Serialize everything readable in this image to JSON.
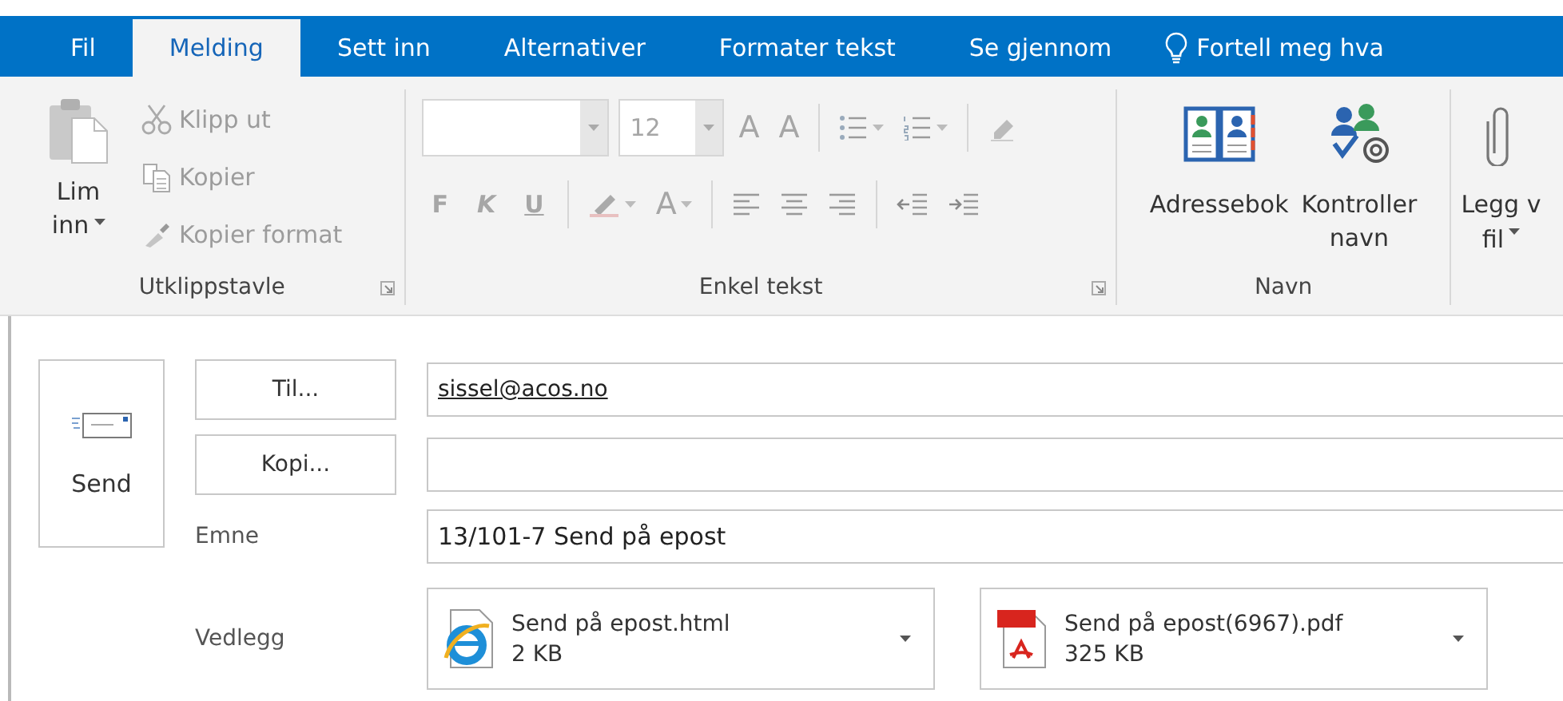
{
  "tabs": [
    {
      "label": "Fil",
      "selected": false
    },
    {
      "label": "Melding",
      "selected": true
    },
    {
      "label": "Sett inn",
      "selected": false
    },
    {
      "label": "Alternativer",
      "selected": false
    },
    {
      "label": "Formater tekst",
      "selected": false
    },
    {
      "label": "Se gjennom",
      "selected": false
    }
  ],
  "tell_me": {
    "label": "Fortell meg hva"
  },
  "clipboard": {
    "title": "Utklippstavle",
    "paste": {
      "lines": [
        "Lim",
        "inn"
      ],
      "disabled": false
    },
    "items": [
      {
        "label": "Klipp ut",
        "kind": "cut",
        "disabled": true
      },
      {
        "label": "Kopier",
        "kind": "copy",
        "disabled": true
      },
      {
        "label": "Kopier format",
        "kind": "brush",
        "disabled": true
      }
    ]
  },
  "basic_text": {
    "title": "Enkel tekst",
    "disabled": true,
    "font_size": "12",
    "grow": "A",
    "shrink": "A",
    "styles": [
      {
        "label": "F",
        "kind": "bold"
      },
      {
        "label": "K",
        "kind": "italic"
      },
      {
        "label": "U",
        "kind": "underline"
      }
    ],
    "font_color": "A"
  },
  "names": {
    "title": "Navn",
    "items": [
      {
        "lines": [
          "Adressebok"
        ],
        "kind": "book"
      },
      {
        "lines": [
          "Kontroller",
          "navn"
        ],
        "kind": "check"
      }
    ]
  },
  "attach": {
    "lines": [
      "Legg v",
      "fil"
    ]
  },
  "send": {
    "label": "Send"
  },
  "recipients": [
    {
      "button": "Til...",
      "value": "sissel@acos.no"
    },
    {
      "button": "Kopi..."
    }
  ],
  "subject": {
    "label": "Emne",
    "value": "13/101-7 Send på epost"
  },
  "attachments": {
    "label": "Vedlegg",
    "files": [
      {
        "name": "Send på epost.html",
        "size": "2 KB",
        "kind": "html"
      },
      {
        "name": "Send på epost(6967).pdf",
        "size": "325 KB",
        "kind": "pdf"
      }
    ]
  }
}
